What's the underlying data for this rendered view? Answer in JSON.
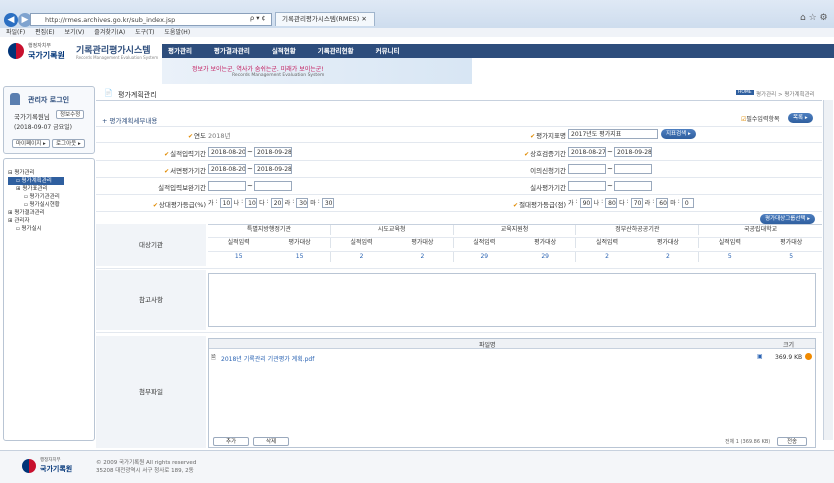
{
  "browser": {
    "url": "http://rmes.archives.go.kr/sub_index.jsp",
    "tab_title": "기록관리평가시스템(RMES)",
    "search_hint": "ρ ▾ ¢",
    "menu": [
      "파일(F)",
      "편집(E)",
      "보기(V)",
      "즐겨찾기(A)",
      "도구(T)",
      "도움말(H)"
    ]
  },
  "header": {
    "org_small": "행정자치부",
    "org": "국가기록원",
    "system": "기록관리평가시스템",
    "system_sub": "Records Management Evaluation System",
    "nav": [
      "평가관리",
      "평가결과관리",
      "실적현황",
      "기록관리현황",
      "커뮤니티"
    ],
    "slogan": "정보가 보이는군. 역사가 숨쉬는군. 미래가 보이는군!",
    "slogan_sub": "Records Management Evaluation System"
  },
  "login": {
    "title": "관리자 로그인",
    "user": "국가기록원님",
    "info_btn": "정보수정",
    "date": "(2018-09-07 금요일)",
    "mypage": "마이페이지 ▸",
    "logout": "로그아웃 ▸"
  },
  "tree": [
    "평가관리",
    "평가계획관리",
    "평가표관리",
    "평가기관관리",
    "평가실시현황",
    "평가결과관리",
    "관리자",
    "평가실시"
  ],
  "page": {
    "title": "평가계획관리",
    "breadcrumb": "평가관리 > 평가계획관리",
    "home": "HOME",
    "section": "평가계획세부내용",
    "required": "필수입력항목",
    "list_btn": "목록 ▸"
  },
  "form": {
    "year_label": "연도",
    "year": "2018년",
    "sheet_label": "평가지표명",
    "sheet": "2017년도 평가지표",
    "sheet_btn": "지표검색 ▸",
    "perf_label": "실적입력기간",
    "perf_from": "2018-08-20",
    "perf_to": "2018-09-28",
    "mutual_label": "상호검증기간",
    "mutual_from": "2018-08-27",
    "mutual_to": "2018-09-28",
    "doc_label": "서면평가기간",
    "doc_from": "2018-08-20",
    "doc_to": "2018-09-28",
    "appeal_label": "이의신청기간",
    "suppl_label": "실적입력보완기간",
    "site_label": "실사평가기간",
    "rel_label": "상대평가등급(%)",
    "rel": [
      [
        "가",
        ":",
        "10"
      ],
      [
        "나",
        ":",
        "10"
      ],
      [
        "다",
        ":",
        "20"
      ],
      [
        "라",
        ":",
        "30"
      ],
      [
        "마",
        ":",
        "30"
      ]
    ],
    "abs_label": "절대평가등급(점)",
    "abs": [
      [
        "가",
        ":",
        "90"
      ],
      [
        "나",
        ":",
        "80"
      ],
      [
        "다",
        ":",
        "70"
      ],
      [
        "라",
        ":",
        "60"
      ],
      [
        "마",
        ":",
        "0"
      ]
    ],
    "org_btn": "평가대상그룹선택 ▸",
    "target_label": "대상기관",
    "groups": [
      "특별지방행정기관",
      "시도교육청",
      "교육지원청",
      "정부산하공공기관",
      "국공립대학교"
    ],
    "subcols": [
      "실적입력",
      "평가대상"
    ],
    "values": [
      [
        "15",
        "15"
      ],
      [
        "2",
        "2"
      ],
      [
        "29",
        "29"
      ],
      [
        "2",
        "2"
      ],
      [
        "5",
        "5"
      ]
    ],
    "note_label": "참고사항",
    "attach_label": "첨부파일",
    "file_col": "파일명",
    "size_col": "크기",
    "file_name": "2018년 기록관리 기관평가 계획.pdf",
    "file_size": "369.9 KB",
    "add_btn": "추가",
    "del_btn": "삭제",
    "total": "전체 1 (369.86 KB)",
    "send_btn": "전송"
  },
  "footer": {
    "copy": "© 2009 국가기록원 All rights reserved",
    "addr": "35208 대전광역시 서구 청사로 189, 2동"
  }
}
